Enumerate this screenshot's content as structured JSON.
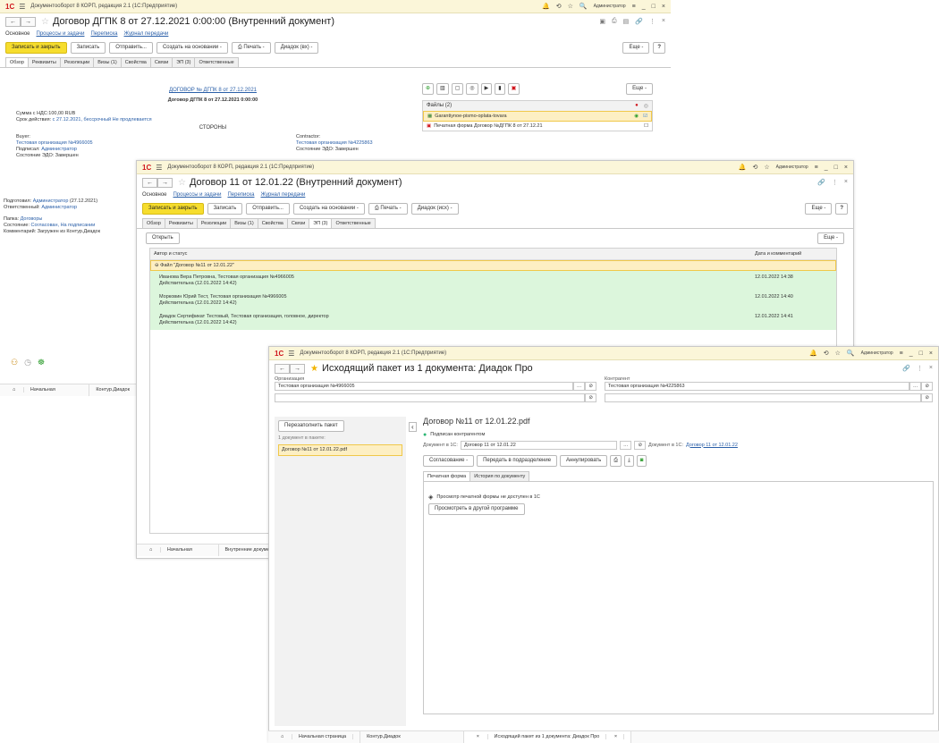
{
  "window1": {
    "titlebar": {
      "app": "Документооборот 8 КОРП, редакция 2.1  (1С:Предприятие)",
      "user": "Администратор"
    },
    "title": "Договор ДГПК 8 от 27.12.2021 0:00:00 (Внутренний документ)",
    "sections": [
      "Основное",
      "Процессы и задачи",
      "Переписка",
      "Журнал передачи"
    ],
    "commands": [
      "Записать и закрыть",
      "Записать",
      "Отправить...",
      "Создать на основании -",
      "Печать -",
      "Диадок (вх) -"
    ],
    "more": "Еще -",
    "help": "?",
    "tabs": [
      "Обзор",
      "Реквизиты",
      "Резолюции",
      "Визы (1)",
      "Свойства",
      "Связи",
      "ЭП (3)",
      "Ответственные"
    ],
    "doc_link": "ДОГОВОР № ДГПК 8 от 27.12.2021",
    "doc_heading": "Договор ДГПК 8 от 27.12.2021 0:00:00",
    "sum": "Сумма с НДС:100,00 RUB",
    "term_label": "Срок действия:",
    "term_value": "с 27.12.2021, бессрочный Не продлевается",
    "parties": "СТОРОНЫ",
    "buyer_label": "Buyer:",
    "buyer_org": "Тестовая организация №4966005",
    "buyer_signed_label": "Подписал:",
    "buyer_signed": "Администратор",
    "buyer_edo": "Состояние ЭДО: Завершен",
    "contractor_label": "Contractor:",
    "contractor_org": "Тестовая организация №4225863",
    "contractor_edo": "Состояние ЭДО: Завершен",
    "prepared_label": "Подготовил:",
    "prepared": "Администратор",
    "prepared_date": "(27.12.2021)",
    "responsible_label": "Ответственный:",
    "responsible": "Администратор",
    "folder_label": "Папка:",
    "folder": "Договоры",
    "state_label": "Состояние:",
    "state": "Согласован, На подписании",
    "comment": "Комментарий: Загружен из Контур.Диадок",
    "files_header": "Файлы (2)",
    "files_more": "Еще -",
    "files": [
      "Garantiynoe-pismo-oplata-tovara",
      "Печатная форма Договор №ДГПК 8 от 27.12.21"
    ],
    "taskbar": [
      "Начальная страница",
      "Контур.Диадок"
    ]
  },
  "window2": {
    "titlebar": {
      "app": "Документооборот 8 КОРП, редакция 2.1  (1С:Предприятие)",
      "user": "Администратор"
    },
    "title": "Договор 11 от 12.01.22 (Внутренний документ)",
    "sections": [
      "Основное",
      "Процессы и задачи",
      "Переписка",
      "Журнал передачи"
    ],
    "commands": [
      "Записать и закрыть",
      "Записать",
      "Отправить...",
      "Создать на основании -",
      "Печать -",
      "Диадок (исх) -"
    ],
    "more": "Еще -",
    "help": "?",
    "tabs": [
      "Обзор",
      "Реквизиты",
      "Резолюции",
      "Визы (1)",
      "Свойства",
      "Связи",
      "ЭП (3)",
      "Ответственные"
    ],
    "open_btn": "Открыть",
    "list_more": "Еще -",
    "col_author": "Автор и статус",
    "col_date": "Дата и комментарий",
    "group": "Файл \"Договор №11 от 12.01.22\"",
    "rows": [
      {
        "name": "Иванова Вера Петровна, Тестовая организация №4966005",
        "status": "Действительна (12.01.2022 14:42)",
        "date": "12.01.2022 14:38"
      },
      {
        "name": "Морковин Юрий Тест, Тестовая организация №4966005",
        "status": "Действительна (12.01.2022 14:42)",
        "date": "12.01.2022 14:40"
      },
      {
        "name": "Диадок Сертификат Тестовый, Тестовая организация, головное, директор",
        "status": "Действительна (12.01.2022 14:42)",
        "date": "12.01.2022 14:41"
      }
    ],
    "taskbar": [
      "Начальная страница",
      "Внутренние докуме"
    ]
  },
  "window3": {
    "titlebar": {
      "app": "Документооборот 8 КОРП, редакция 2.1  (1С:Предприятие)",
      "user": "Администратор"
    },
    "title": "Исходящий пакет из 1 документа: Диадок Про",
    "org_label": "Организация",
    "org_value": "Тестовая организация №4966005",
    "contr_label": "Контрагент",
    "contr_value": "Тестовая организация №4225863",
    "refill_btn": "Перезаполнить пакет",
    "docs_count": "1 документ в пакете:",
    "doc_item": "Договор №11 от 12.01.22.pdf",
    "doc_title": "Договор №11 от 12.01.22.pdf",
    "status": "Подписан контрагентом",
    "doc1c_label": "Документ в 1С:",
    "doc1c_value": "Договор 11 от 12.01.22",
    "doc1c_label2": "Документ в 1С:",
    "doc1c_link": "Договор 11 от 12.01.22",
    "actions": [
      "Согласование -",
      "Передать в подразделение",
      "Аннулировать"
    ],
    "tabs": [
      "Печатная форма",
      "История по документу"
    ],
    "preview_msg": "Просмотр печатной формы не доступен в 1С",
    "preview_btn": "Просмотреть в другой программе",
    "taskbar": [
      "Начальная страница",
      "Контур.Диадок",
      "Исходящий пакет из 1 документа: Диадок Про"
    ]
  }
}
